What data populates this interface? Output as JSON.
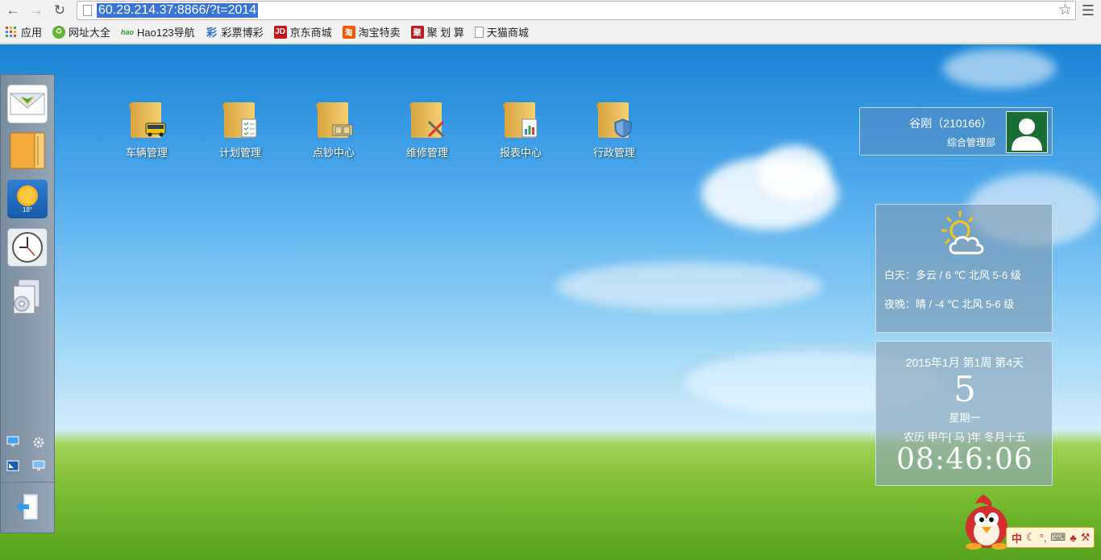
{
  "browser": {
    "url": "60.29.214.37:8866/?t=2014",
    "bookmarks": [
      {
        "label": "应用",
        "icon": "apps-grid-icon",
        "color": "#d93b2b"
      },
      {
        "label": "网址大全",
        "icon": "360-icon",
        "color": "#4caf2f"
      },
      {
        "label": "Hao123导航",
        "icon": "hao123-icon",
        "color": "#e0851b"
      },
      {
        "label": "彩票博彩",
        "icon": "lottery-icon",
        "color": "#2d6fcf"
      },
      {
        "label": "京东商城",
        "icon": "jd-icon",
        "color": "#c8161d"
      },
      {
        "label": "淘宝特卖",
        "icon": "taobao-icon",
        "color": "#ff5500"
      },
      {
        "label": "聚 划 算",
        "icon": "juhuasuan-icon",
        "color": "#b51f1f"
      },
      {
        "label": "天猫商城",
        "icon": "page-icon",
        "color": "#ffffff"
      }
    ]
  },
  "desktop_icons": [
    {
      "label": "车辆管理",
      "icon": "vehicle-folder-icon"
    },
    {
      "label": "计划管理",
      "icon": "plan-folder-icon"
    },
    {
      "label": "点钞中心",
      "icon": "cash-folder-icon"
    },
    {
      "label": "维修管理",
      "icon": "repair-folder-icon"
    },
    {
      "label": "报表中心",
      "icon": "report-folder-icon"
    },
    {
      "label": "行政管理",
      "icon": "admin-folder-icon"
    }
  ],
  "user": {
    "name": "谷刚（210166）",
    "department": "综合管理部"
  },
  "weather": {
    "day": "白天：多云 / 6 ℃ 北风 5-6 级",
    "night": "夜晚：晴 / -4 ℃ 北风 5-6 级"
  },
  "calendar": {
    "header": "2015年1月  第1周 第4天",
    "day": "5",
    "weekday": "星期一",
    "lunar": "农历 甲午[ 马 ]年 冬月十五",
    "time": "08:46:06"
  },
  "dock": {
    "sun_temp": "18°"
  },
  "ime": {
    "mode": "中"
  },
  "colors": {
    "accent": "#3875d7",
    "avatar_bg": "#1a6e35"
  }
}
